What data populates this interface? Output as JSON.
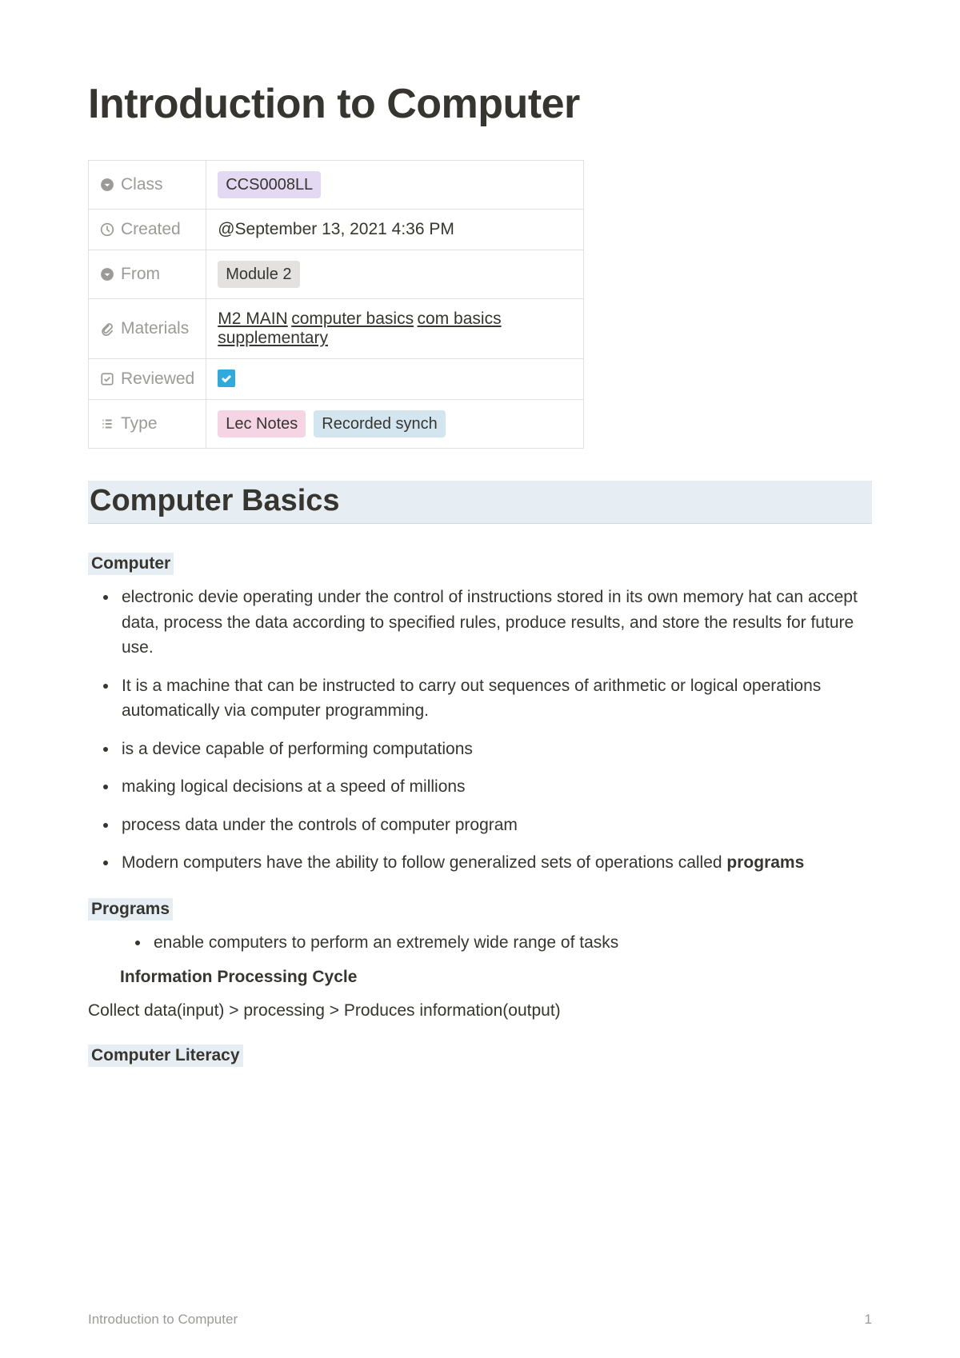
{
  "title": "Introduction to Computer",
  "properties": {
    "class": {
      "label": "Class",
      "value": "CCS0008LL"
    },
    "created": {
      "label": "Created",
      "value": "@September 13, 2021 4:36 PM"
    },
    "from": {
      "label": "From",
      "value": "Module 2"
    },
    "materials": {
      "label": "Materials",
      "links": [
        "M2 MAIN",
        "computer basics",
        "com basics supplementary"
      ]
    },
    "reviewed": {
      "label": "Reviewed",
      "checked": true
    },
    "type": {
      "label": "Type",
      "tags": [
        "Lec Notes",
        "Recorded synch"
      ]
    }
  },
  "section_heading": "Computer Basics",
  "computer": {
    "heading": "Computer",
    "bullets": [
      "electronic devie operating under the control of instructions stored in its own memory hat can accept data, process the data according to specified rules, produce results, and store the results for future use.",
      "It is a machine that can be instructed to carry out sequences of arithmetic or logical operations automatically via computer programming.",
      "is a device capable of performing computations",
      "making logical decisions at a speed of millions",
      "process data under the controls of computer program"
    ],
    "bullet6_prefix": "Modern computers have the ability to follow generalized sets of operations called ",
    "bullet6_bold": "programs"
  },
  "programs": {
    "heading": "Programs",
    "bullets": [
      "enable computers to perform an extremely wide range of tasks"
    ]
  },
  "ipc": {
    "heading": "Information Processing Cycle",
    "text": "Collect data(input) > processing > Produces information(output)"
  },
  "literacy": {
    "heading": "Computer Literacy"
  },
  "footer": {
    "title": "Introduction to Computer",
    "page": "1"
  }
}
